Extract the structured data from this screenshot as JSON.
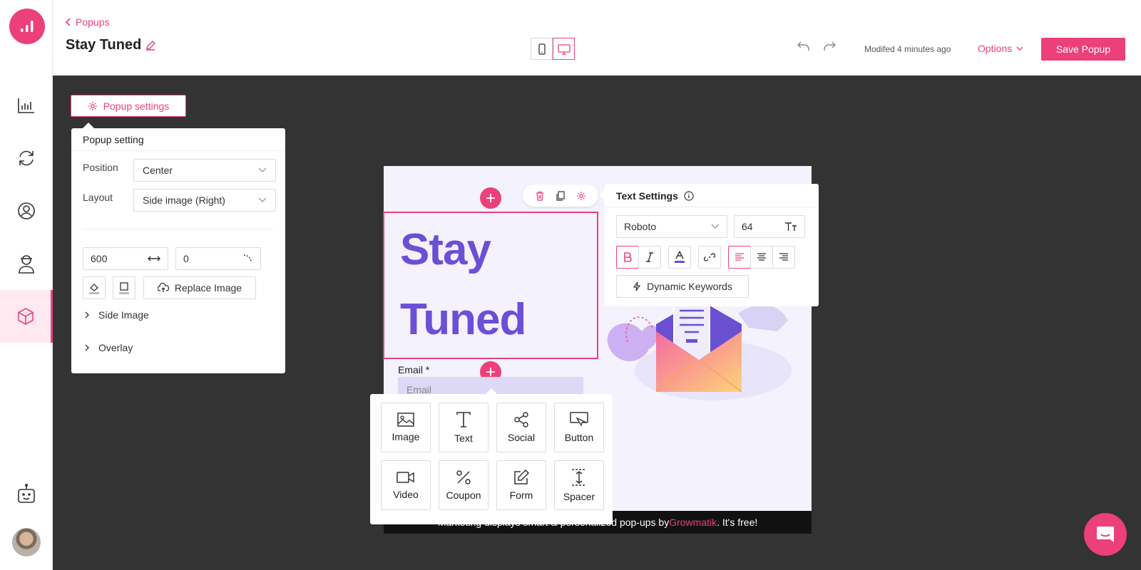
{
  "header": {
    "back_label": "Popups",
    "title": "Stay Tuned",
    "modified": "Modifed 4 minutes ago",
    "options_label": "Options",
    "save_label": "Save Popup"
  },
  "sidebar": {
    "items": [
      {
        "icon": "analytics-icon",
        "active": false
      },
      {
        "icon": "sync-icon",
        "active": false
      },
      {
        "icon": "audience-icon",
        "active": false
      },
      {
        "icon": "agent-icon",
        "active": false
      },
      {
        "icon": "cube-icon",
        "active": true
      }
    ],
    "bot_icon": "bot-icon"
  },
  "settings": {
    "button_label": "Popup settings",
    "panel_title": "Popup setting",
    "position_label": "Position",
    "position_value": "Center",
    "layout_label": "Layout",
    "layout_value": "Side image (Right)",
    "width_value": "600",
    "radius_value": "0",
    "replace_label": "Replace Image",
    "side_image_label": "Side Image",
    "overlay_label": "Overlay"
  },
  "canvas": {
    "headline_line1": "Stay",
    "headline_line2": "Tuned",
    "email_label": "Email *",
    "email_placeholder": "Email",
    "footer_text": "Marketing displays smart & personalized pop-ups by ",
    "footer_brand": "Growmatik",
    "footer_suffix": ". It's free!"
  },
  "text_settings": {
    "title": "Text Settings",
    "font": "Roboto",
    "size": "64",
    "dynamic_label": "Dynamic Keywords"
  },
  "picker": {
    "items": [
      "Image",
      "Text",
      "Social",
      "Button",
      "Video",
      "Coupon",
      "Form",
      "Spacer"
    ]
  },
  "colors": {
    "accent": "#ec407a",
    "headline": "#6b4fd6",
    "canvas_bg": "#333333"
  }
}
